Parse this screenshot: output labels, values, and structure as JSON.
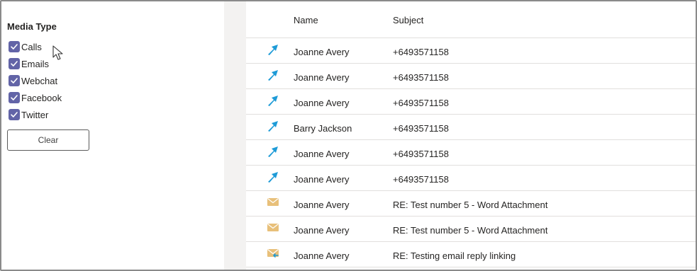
{
  "filter": {
    "title": "Media Type",
    "options": [
      {
        "label": "Calls",
        "checked": true
      },
      {
        "label": "Emails",
        "checked": true
      },
      {
        "label": "Webchat",
        "checked": true
      },
      {
        "label": "Facebook",
        "checked": true
      },
      {
        "label": "Twitter",
        "checked": true
      }
    ],
    "clear_label": "Clear",
    "checkbox_color": "#6264a7"
  },
  "list": {
    "columns": {
      "name": "Name",
      "subject": "Subject"
    },
    "rows": [
      {
        "icon": "call-arrow-icon",
        "name": "Joanne Avery",
        "subject": "+6493571158"
      },
      {
        "icon": "call-arrow-icon",
        "name": "Joanne Avery",
        "subject": "+6493571158"
      },
      {
        "icon": "call-arrow-icon",
        "name": "Joanne Avery",
        "subject": "+6493571158"
      },
      {
        "icon": "call-arrow-icon",
        "name": "Barry Jackson",
        "subject": "+6493571158"
      },
      {
        "icon": "call-arrow-icon",
        "name": "Joanne Avery",
        "subject": "+6493571158"
      },
      {
        "icon": "call-arrow-icon",
        "name": "Joanne Avery",
        "subject": "+6493571158"
      },
      {
        "icon": "envelope-icon",
        "name": "Joanne Avery",
        "subject": "RE: Test number 5 - Word Attachment"
      },
      {
        "icon": "envelope-icon",
        "name": "Joanne Avery",
        "subject": "RE: Test number 5 - Word Attachment"
      },
      {
        "icon": "envelope-reply-icon",
        "name": "Joanne Avery",
        "subject": "RE: Testing email reply linking"
      }
    ],
    "call_icon_color": "#1e9bd7",
    "email_icon_color": "#e8c07a"
  }
}
